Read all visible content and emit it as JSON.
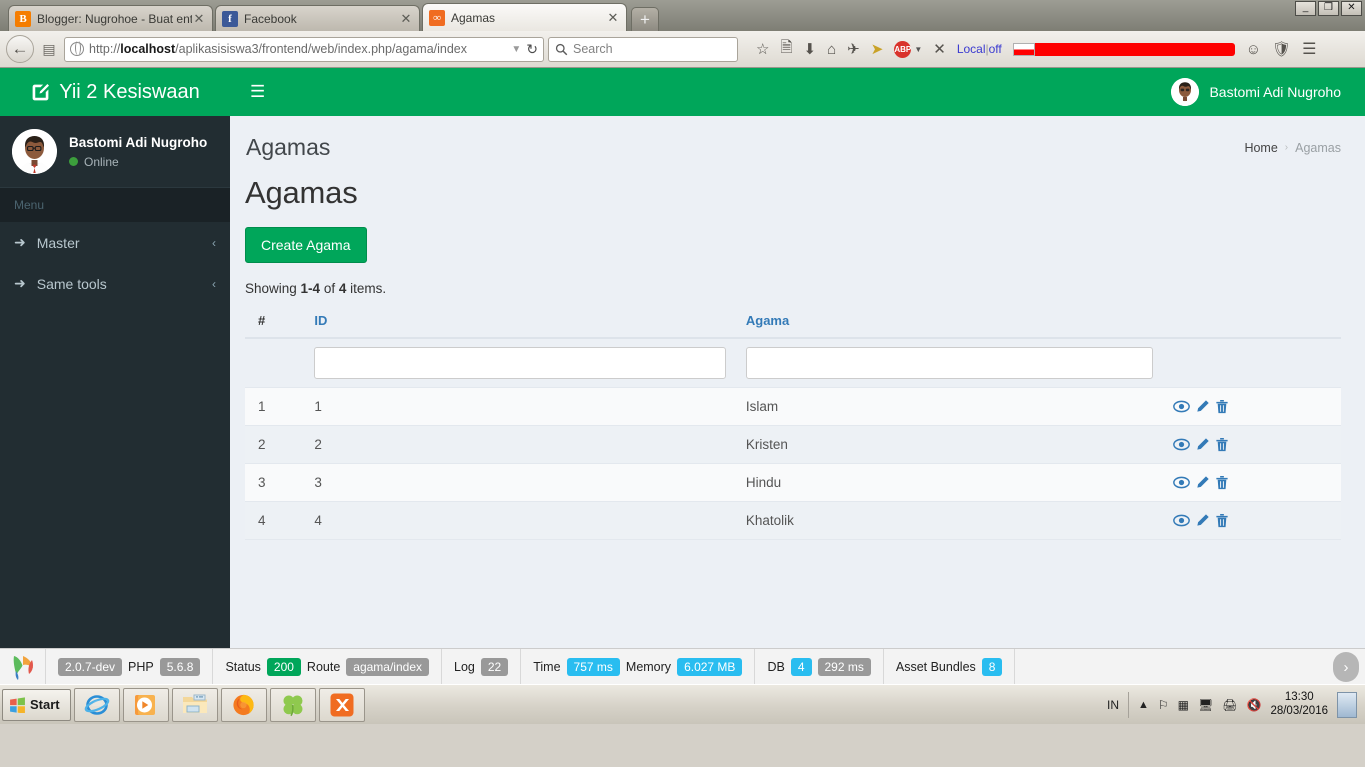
{
  "browser": {
    "tabs": [
      {
        "title": "Blogger: Nugrohoe - Buat entri",
        "favicon": "blogger-icon",
        "favicon_glyph": "B",
        "active": false
      },
      {
        "title": "Facebook",
        "favicon": "facebook-icon",
        "favicon_glyph": "f",
        "active": false
      },
      {
        "title": "Agamas",
        "favicon": "xampp-icon",
        "favicon_glyph": "∞",
        "active": true
      }
    ],
    "new_tab_label": "+",
    "window_controls": {
      "minimize": "_",
      "restore": "❐",
      "close": "✕"
    },
    "url_prefix": "http://",
    "url_host": "localhost",
    "url_path": "/aplikasisiswa3/frontend/web/index.php/agama/index",
    "search_placeholder": "Search",
    "local_off_label": "Local | off",
    "toolbar_icons": [
      "bookmark-star-icon",
      "reading-list-icon",
      "download-icon",
      "home-icon",
      "pocket-icon",
      "cursor-icon",
      "adblock-plus-icon",
      "close-x-icon",
      "smiley-icon",
      "shield-icon",
      "menu-hamburger-icon"
    ],
    "adblock_label": "ABP"
  },
  "sidebar": {
    "brand": "Yii 2 Kesiswaan",
    "brand_icon": "edit-square-icon",
    "user": {
      "name": "Bastomi Adi Nugroho",
      "status": "Online",
      "avatar": "user-avatar"
    },
    "menu_header": "Menu",
    "items": [
      {
        "label": "Master",
        "icon": "share-arrow-icon",
        "chevron": "‹"
      },
      {
        "label": "Same tools",
        "icon": "share-arrow-icon",
        "chevron": "‹"
      }
    ]
  },
  "topbar": {
    "toggle_icon": "hamburger-icon",
    "user_name": "Bastomi Adi Nugroho",
    "avatar": "user-avatar-small"
  },
  "content_header": {
    "title": "Agamas",
    "breadcrumb": [
      {
        "label": "Home",
        "current": false
      },
      {
        "label": "Agamas",
        "current": true
      }
    ],
    "breadcrumb_separator": "›"
  },
  "main": {
    "heading": "Agamas",
    "create_button": "Create Agama",
    "summary_prefix": "Showing ",
    "summary_range": "1-4",
    "summary_mid": " of ",
    "summary_total": "4",
    "summary_suffix": " items.",
    "table": {
      "columns": [
        {
          "key": "num",
          "label": "#"
        },
        {
          "key": "id",
          "label": "ID"
        },
        {
          "key": "agama",
          "label": "Agama"
        },
        {
          "key": "actions",
          "label": ""
        }
      ],
      "filters": {
        "id": "",
        "agama": ""
      },
      "rows": [
        {
          "num": "1",
          "id": "1",
          "agama": "Islam"
        },
        {
          "num": "2",
          "id": "2",
          "agama": "Kristen"
        },
        {
          "num": "3",
          "id": "3",
          "agama": "Hindu"
        },
        {
          "num": "4",
          "id": "4",
          "agama": "Khatolik"
        }
      ],
      "row_actions": [
        "view-eye-icon",
        "update-pencil-icon",
        "delete-trash-icon"
      ],
      "action_color": "#337ab7"
    }
  },
  "debug_toolbar": {
    "logo": "yii-logo-icon",
    "version": "2.0.7-dev",
    "php_label": "PHP",
    "php_version": "5.6.8",
    "status_label": "Status",
    "status_code": "200",
    "route_label": "Route",
    "route_value": "agama/index",
    "log_label": "Log",
    "log_count": "22",
    "time_label": "Time",
    "time_value": "757 ms",
    "memory_label": "Memory",
    "memory_value": "6.027 MB",
    "db_label": "DB",
    "db_count": "4",
    "db_time": "292 ms",
    "asset_label": "Asset Bundles",
    "asset_count": "8",
    "toggle_icon": "chevron-right-icon"
  },
  "taskbar": {
    "start_label": "Start",
    "apps": [
      "internet-explorer-icon",
      "media-player-icon",
      "file-explorer-icon",
      "firefox-icon",
      "clover-icon",
      "xampp-icon"
    ],
    "tray": {
      "language": "IN",
      "icons": [
        "show-hidden-icons-icon",
        "flag-action-center-icon",
        "windows-icon",
        "network-icon",
        "printer-icon",
        "volume-muted-icon"
      ],
      "time": "13:30",
      "date": "28/03/2016",
      "show_desktop": "show-desktop-icon"
    }
  },
  "theme": {
    "green": "#00a65a",
    "sidebar_dark": "#222d32",
    "page_bg": "#ecf0f5",
    "link_blue": "#337ab7"
  }
}
